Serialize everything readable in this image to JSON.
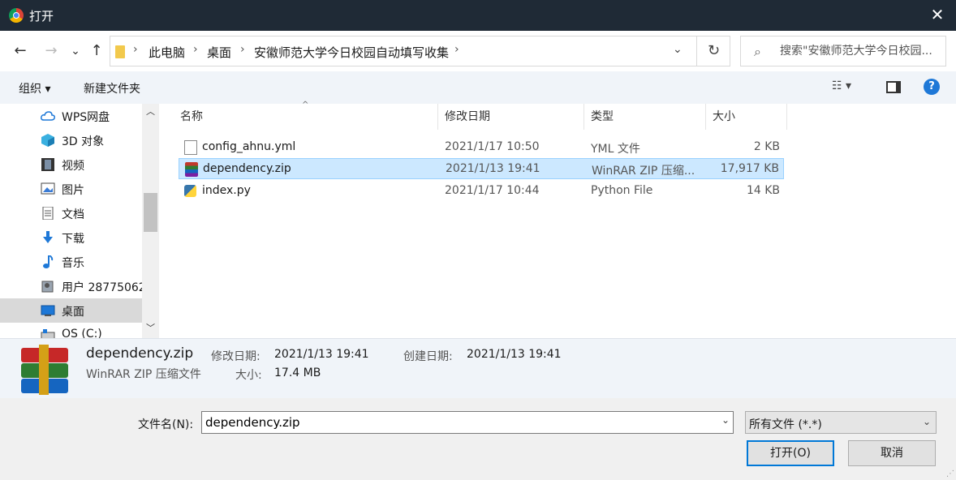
{
  "window": {
    "title": "打开",
    "close_glyph": "✕"
  },
  "nav": {
    "back": "←",
    "forward": "→",
    "recent": "⌄",
    "up": "↑"
  },
  "address": {
    "crumbs": [
      "此电脑",
      "桌面",
      "安徽师范大学今日校园自动填写收集"
    ],
    "sep": "›",
    "dropdown": "⌄",
    "refresh": "↻"
  },
  "search": {
    "placeholder": "搜索\"安徽师范大学今日校园...",
    "icon_glyph": "⌕"
  },
  "toolbar": {
    "organize": "组织 ▾",
    "new_folder": "新建文件夹",
    "view": "☷ ▾",
    "help": "?"
  },
  "sidebar": {
    "items": [
      {
        "label": "WPS网盘",
        "icon": "cloud-icon"
      },
      {
        "label": "3D 对象",
        "icon": "cube-icon"
      },
      {
        "label": "视频",
        "icon": "film-icon"
      },
      {
        "label": "图片",
        "icon": "picture-icon"
      },
      {
        "label": "文档",
        "icon": "document-icon"
      },
      {
        "label": "下载",
        "icon": "download-icon"
      },
      {
        "label": "音乐",
        "icon": "music-icon"
      },
      {
        "label": "用户 28775062",
        "icon": "user-folder-icon"
      },
      {
        "label": "桌面",
        "icon": "desktop-icon"
      },
      {
        "label": "OS (C:)",
        "icon": "drive-icon"
      }
    ],
    "selected_index": 8,
    "scroll_up": "︿",
    "scroll_down": "﹀"
  },
  "columns": {
    "name": "名称",
    "modified": "修改日期",
    "type": "类型",
    "size": "大小",
    "sort_glyph": "^"
  },
  "files": [
    {
      "name": "config_ahnu.yml",
      "modified": "2021/1/17 10:50",
      "type": "YML 文件",
      "size": "2 KB",
      "icon": "file-icon"
    },
    {
      "name": "dependency.zip",
      "modified": "2021/1/13 19:41",
      "type": "WinRAR ZIP 压缩...",
      "size": "17,917 KB",
      "icon": "winrar-icon"
    },
    {
      "name": "index.py",
      "modified": "2021/1/17 10:44",
      "type": "Python File",
      "size": "14 KB",
      "icon": "python-icon"
    }
  ],
  "selected_file_index": 1,
  "details": {
    "name": "dependency.zip",
    "type": "WinRAR ZIP 压缩文件",
    "modified_label": "修改日期:",
    "modified_value": "2021/1/13 19:41",
    "created_label": "创建日期:",
    "created_value": "2021/1/13 19:41",
    "size_label": "大小:",
    "size_value": "17.4 MB"
  },
  "footer": {
    "filename_label": "文件名(N):",
    "filename_value": "dependency.zip",
    "filetype_value": "所有文件 (*.*)",
    "chevron": "⌄",
    "open": "打开(O)",
    "cancel": "取消"
  }
}
